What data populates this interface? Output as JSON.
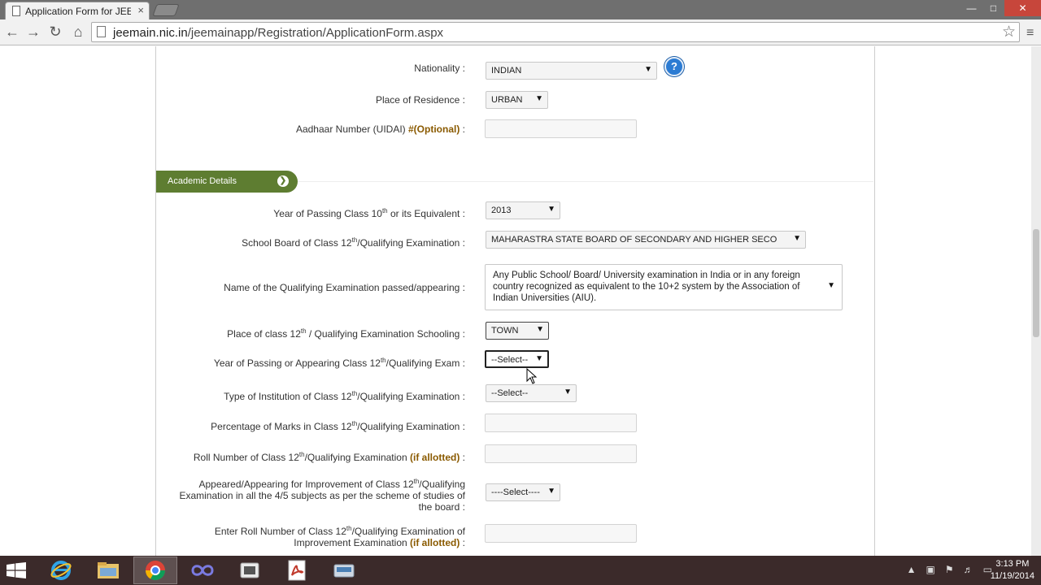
{
  "browser": {
    "tab_title": "Application Form for JEE(I",
    "tab_close": "×",
    "url_host": "jeemain.nic.in",
    "url_path": "/jeemainapp/Registration/ApplicationForm.aspx"
  },
  "personal": {
    "nationality_label": "Nationality :",
    "nationality_value": "INDIAN",
    "residence_label": "Place of Residence :",
    "residence_value": "URBAN",
    "aadhaar_label_main": "Aadhaar Number (UIDAI) ",
    "aadhaar_label_opt": "#(Optional)",
    "aadhaar_label_tail": " :",
    "aadhaar_value": "",
    "help_text": "?"
  },
  "academic": {
    "section_title": "Academic Details",
    "section_icon": "chevron-right-circle-icon",
    "year10": {
      "label_a": "Year of Passing Class 10",
      "label_sup": "th",
      "label_b": " or its Equivalent :",
      "value": "2013"
    },
    "board12": {
      "label_a": "School Board of Class 12",
      "label_sup": "th",
      "label_b": "/Qualifying Examination :",
      "value": "MAHARASTRA STATE BOARD OF SECONDARY AND HIGHER SECO"
    },
    "qualifying_name": {
      "label": "Name of the Qualifying Examination passed/appearing :",
      "value": "Any Public School/ Board/ University examination in India or in any foreign country recognized as equivalent to the 10+2 system by the Association of Indian Universities (AIU)."
    },
    "place12": {
      "label_a": "Place of class 12",
      "label_sup": "th",
      "label_b": " / Qualifying Examination Schooling :",
      "value": "TOWN"
    },
    "year12": {
      "label_a": "Year of Passing or Appearing Class 12",
      "label_sup": "th",
      "label_b": "/Qualifying Exam :",
      "value": "--Select--"
    },
    "institution": {
      "label_a": "Type of Institution of Class 12",
      "label_sup": "th",
      "label_b": "/Qualifying Examination :",
      "value": "--Select--"
    },
    "percentage": {
      "label_a": "Percentage of Marks in Class 12",
      "label_sup": "th",
      "label_b": "/Qualifying Examination :",
      "value": ""
    },
    "roll": {
      "label_a": "Roll Number of Class 12",
      "label_sup": "th",
      "label_b": "/Qualifying Examination ",
      "label_opt": "(if allotted)",
      "label_tail": " :",
      "value": ""
    },
    "improvement": {
      "line1_a": "Appeared/Appearing for Improvement of Class 12",
      "line1_sup": "th",
      "line1_b": "/Qualifying",
      "line2": "Examination in all the 4/5 subjects as per the scheme of studies of",
      "line3": "the board :",
      "value": "----Select----"
    },
    "improvement_roll": {
      "line1_a": "Enter Roll Number of Class 12",
      "line1_sup": "th",
      "line1_b": "/Qualifying Examination of",
      "line2_a": "Improvement Examination ",
      "line2_opt": "(if allotted)",
      "line2_tail": " :",
      "value": ""
    }
  },
  "taskbar": {
    "time": "3:13 PM",
    "date": "11/19/2014",
    "items": [
      "internet-explorer-icon",
      "file-explorer-icon",
      "chrome-icon",
      "infinity-app-icon",
      "media-icon",
      "pdf-icon",
      "scanner-icon"
    ]
  },
  "colors": {
    "section_green": "#5e7d31",
    "optional_text": "#8a5a00",
    "help_blue": "#2b7bd3",
    "taskbar": "#3b2a2a"
  }
}
